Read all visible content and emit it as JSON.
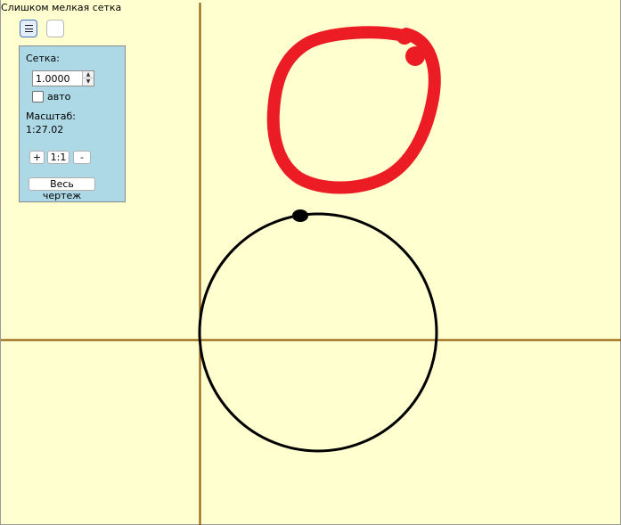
{
  "status_text": "Слишком мелкая сетка",
  "panel": {
    "grid_label": "Сетка:",
    "grid_value": "1.0000",
    "auto_label": "авто",
    "auto_checked": false,
    "scale_label": "Масштаб:",
    "scale_value": "1:27.02",
    "zoom_in_label": "+",
    "zoom_reset_label": "1:1",
    "zoom_out_label": "-",
    "fit_label": "Весь чертеж"
  },
  "icons": {
    "menu": "menu-icon",
    "spin_up": "spin-up-arrow-icon",
    "spin_down": "spin-down-arrow-icon"
  },
  "colors": {
    "canvas_bg": "#ffffd0",
    "axis": "#8b5a00",
    "red_stroke": "#ec1c24",
    "black_stroke": "#000000",
    "panel_bg": "#add8e6"
  }
}
